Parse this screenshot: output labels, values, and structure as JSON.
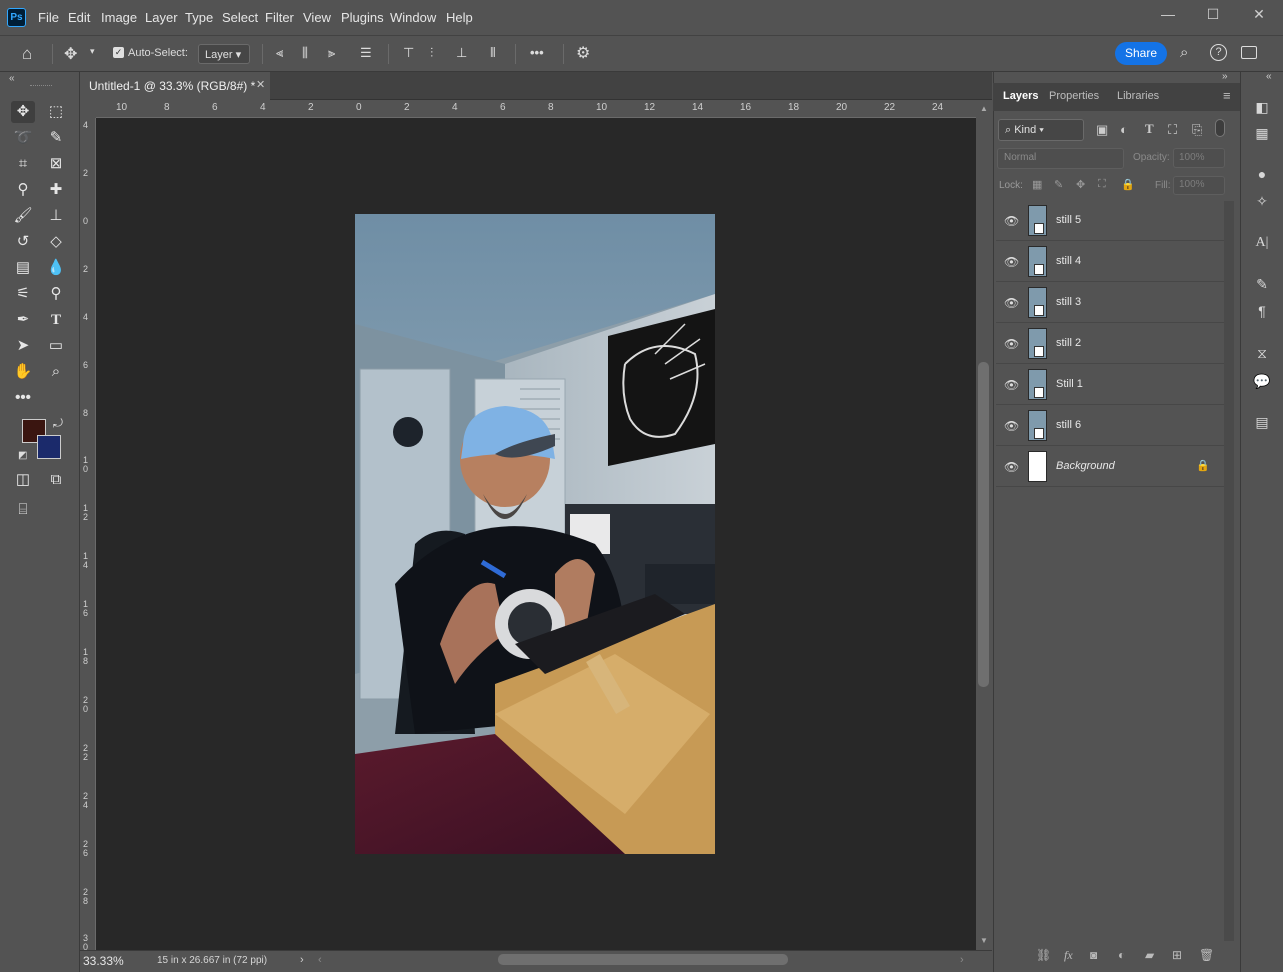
{
  "app": {
    "logo": "Ps"
  },
  "menu": [
    "File",
    "Edit",
    "Image",
    "Layer",
    "Type",
    "Select",
    "Filter",
    "View",
    "Plugins",
    "Window",
    "Help"
  ],
  "window_controls": {
    "minimize": "—",
    "maximize": "☐",
    "close": "✕"
  },
  "options_bar": {
    "auto_select_label": "Auto-Select:",
    "auto_select_checked": true,
    "auto_select_target": "Layer",
    "more": "•••",
    "share_label": "Share"
  },
  "document": {
    "tab_title": "Untitled-1 @ 33.3% (RGB/8#) *",
    "zoom": "33.33%",
    "doc_size": "15 in x 26.667 in (72 ppi)"
  },
  "ruler_top": [
    "10",
    "8",
    "6",
    "4",
    "2",
    "0",
    "2",
    "4",
    "6",
    "8",
    "10",
    "12",
    "14",
    "16",
    "18",
    "20",
    "22",
    "24"
  ],
  "ruler_left": [
    "4",
    "2",
    "0",
    "2",
    "4",
    "6",
    "8",
    "1 0",
    "1 2",
    "1 4",
    "1 6",
    "1 8",
    "2 0",
    "2 2",
    "2 4",
    "2 6",
    "2 8",
    "3 0"
  ],
  "panel": {
    "tabs": [
      "Layers",
      "Properties",
      "Libraries"
    ],
    "filter_kind": "Kind",
    "blend_mode": "Normal",
    "opacity_label": "Opacity:",
    "opacity_value": "100%",
    "lock_label": "Lock:",
    "fill_label": "Fill:",
    "fill_value": "100%",
    "layers": [
      {
        "name": "still 5",
        "visible": true
      },
      {
        "name": "still 4",
        "visible": true
      },
      {
        "name": "still 3",
        "visible": true
      },
      {
        "name": "still 2",
        "visible": true
      },
      {
        "name": "Still 1",
        "visible": true
      },
      {
        "name": "still 6",
        "visible": true
      },
      {
        "name": "Background",
        "visible": true,
        "locked": true
      }
    ]
  },
  "colors": {
    "foreground": "#3a1510",
    "background": "#1b2a6b",
    "accent": "#1473e6"
  }
}
